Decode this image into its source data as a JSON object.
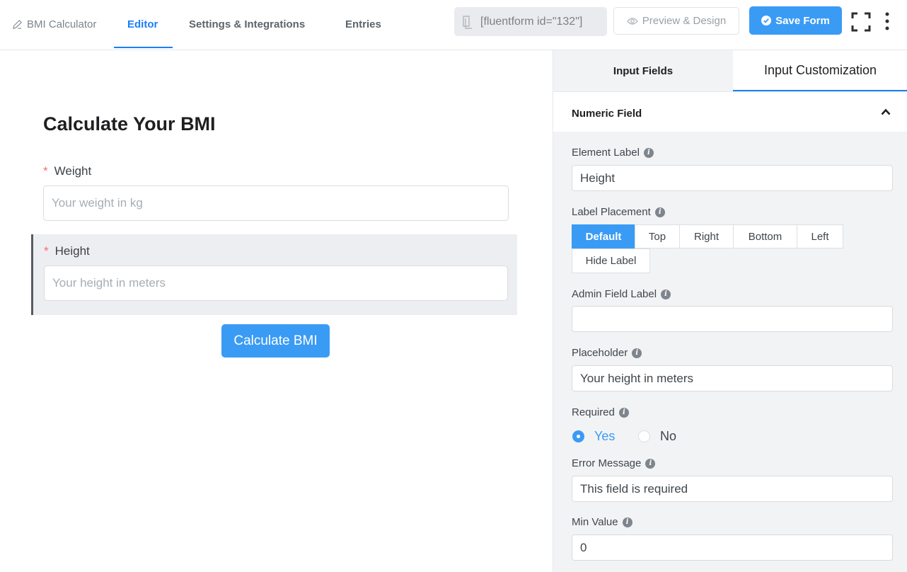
{
  "header": {
    "form_name": "BMI Calculator",
    "tabs": [
      {
        "label": "Editor",
        "active": true
      },
      {
        "label": "Settings & Integrations",
        "active": false
      },
      {
        "label": "Entries",
        "active": false
      }
    ],
    "shortcode": "[fluentform id=\"132\"]",
    "preview_label": "Preview & Design",
    "save_label": "Save Form",
    "accent_color": "#1a7efb"
  },
  "form": {
    "title": "Calculate Your BMI",
    "fields": [
      {
        "label": "Weight",
        "required_mark": "*",
        "placeholder": "Your weight in kg"
      },
      {
        "label": "Height",
        "required_mark": "*",
        "placeholder": "Your height in meters",
        "selected": true
      }
    ],
    "submit_label": "Calculate BMI"
  },
  "sidebar": {
    "tabs": [
      {
        "label": "Input Fields",
        "active": false
      },
      {
        "label": "Input Customization",
        "active": true
      }
    ],
    "section_title": "Numeric Field",
    "element_label": {
      "label": "Element Label",
      "value": "Height"
    },
    "label_placement": {
      "label": "Label Placement",
      "options": [
        "Default",
        "Top",
        "Right",
        "Bottom",
        "Left",
        "Hide Label"
      ],
      "selected": "Default"
    },
    "admin_field_label": {
      "label": "Admin Field Label",
      "value": ""
    },
    "placeholder": {
      "label": "Placeholder",
      "value": "Your height in meters"
    },
    "required": {
      "label": "Required",
      "options": [
        "Yes",
        "No"
      ],
      "selected": "Yes"
    },
    "error_message": {
      "label": "Error Message",
      "value": "This field is required"
    },
    "min_value": {
      "label": "Min Value",
      "value": "0"
    }
  }
}
